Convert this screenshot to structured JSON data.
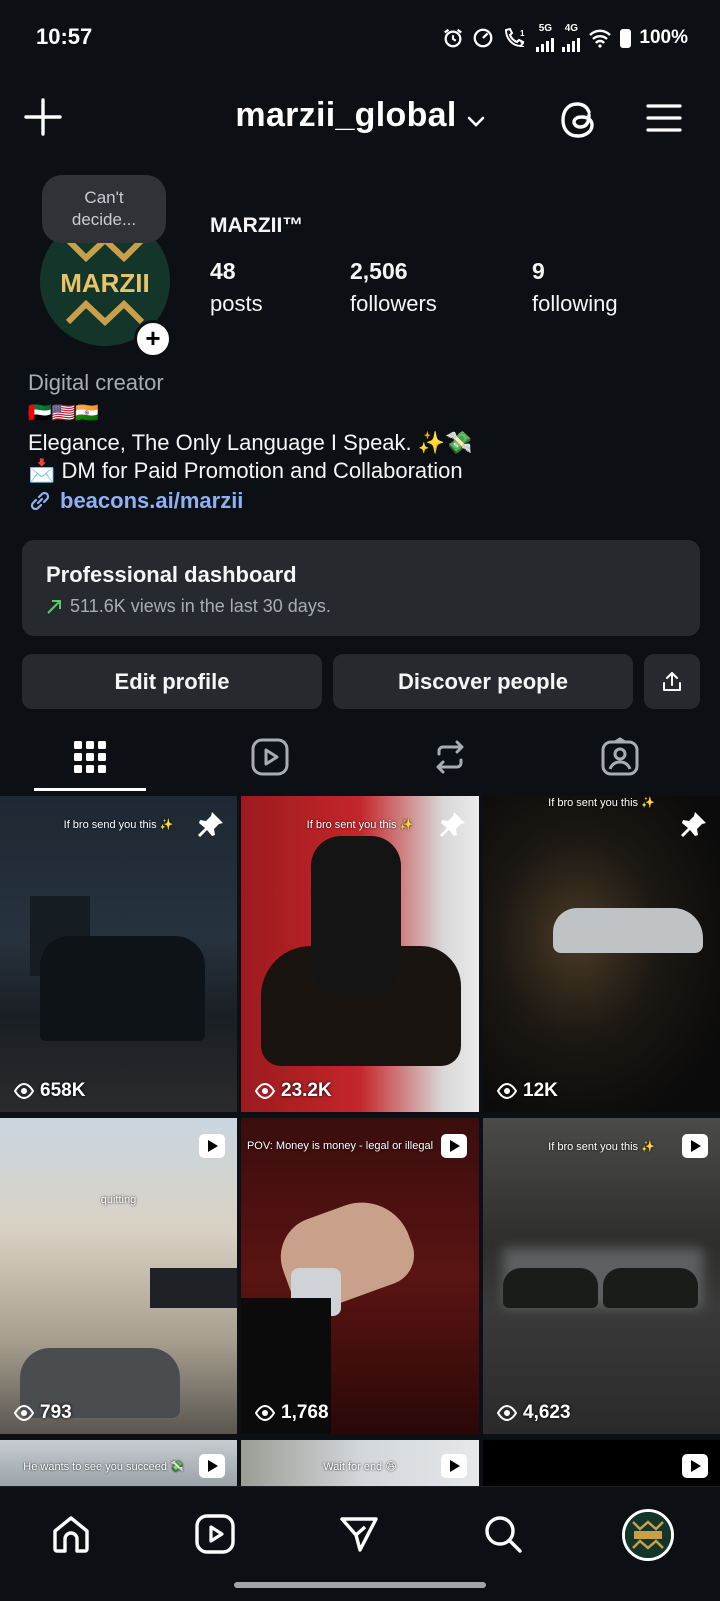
{
  "status_bar": {
    "time": "10:57",
    "net1": "5G",
    "net2": "4G",
    "battery": "100%"
  },
  "header": {
    "username": "marzii_global",
    "icons": [
      "plus-icon",
      "chevron-down-icon",
      "threads-icon",
      "hamburger-menu-icon"
    ]
  },
  "profile": {
    "note": [
      "Can't",
      "decide..."
    ],
    "avatar_text": "MARZII",
    "display_name": "MARZII™",
    "stats": [
      {
        "num": "48",
        "label": "posts"
      },
      {
        "num": "2,506",
        "label": "followers"
      },
      {
        "num": "9",
        "label": "following"
      }
    ],
    "category": "Digital creator",
    "flags": "🇦🇪🇺🇸🇮🇳",
    "bio_line1": "Elegance, The Only Language I Speak. ✨💸",
    "bio_line2": "📩 DM for Paid Promotion and Collaboration",
    "link": "beacons.ai/marzii"
  },
  "dashboard": {
    "title": "Professional dashboard",
    "subtitle": "511.6K views in the last 30 days.",
    "accent": "#5fc76e"
  },
  "actions": {
    "edit": "Edit profile",
    "discover": "Discover people"
  },
  "tabs": [
    "grid-icon",
    "reels-icon",
    "reposts-icon",
    "tagged-icon"
  ],
  "grid": [
    {
      "caption": "If bro send you this ✨",
      "views": "658K",
      "badge": "pin"
    },
    {
      "caption": "If bro sent you this ✨",
      "views": "23.2K",
      "badge": "pin"
    },
    {
      "caption": "If bro sent you this ✨",
      "views": "12K",
      "badge": "pin"
    },
    {
      "caption": "quitting",
      "views": "793",
      "badge": "reel"
    },
    {
      "caption": "POV: Money is money - legal or illegal",
      "views": "1,768",
      "badge": "reel"
    },
    {
      "caption": "If bro sent you this ✨",
      "views": "4,623",
      "badge": "reel"
    },
    {
      "caption": "He wants to see you succeed 💸",
      "views": "",
      "badge": "reel"
    },
    {
      "caption": "Wait for end 😆",
      "views": "",
      "badge": "reel"
    },
    {
      "caption": "",
      "views": "",
      "badge": "reel"
    }
  ],
  "nav": [
    "home-icon",
    "reels-icon",
    "send-icon",
    "search-icon",
    "profile-avatar"
  ]
}
